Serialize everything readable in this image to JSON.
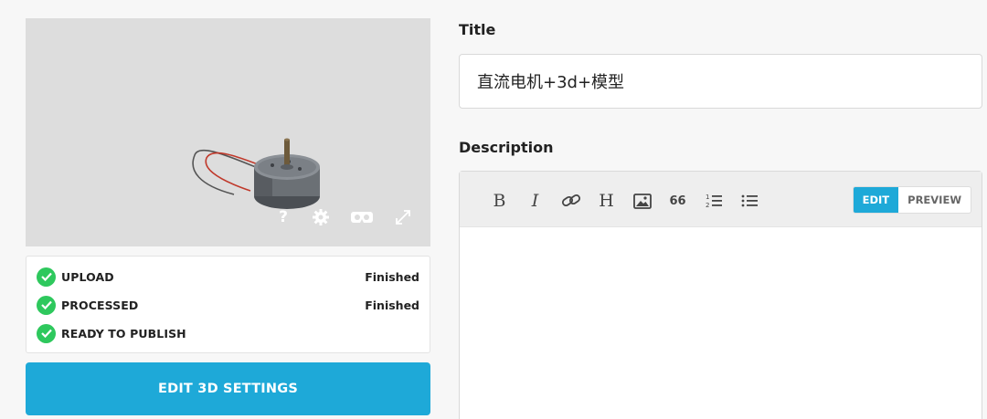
{
  "viewer": {
    "controls": [
      "help-icon",
      "settings-icon",
      "vr-icon",
      "fullscreen-icon"
    ],
    "help_glyph": "?"
  },
  "status": {
    "items": [
      {
        "label": "UPLOAD",
        "state": "Finished"
      },
      {
        "label": "PROCESSED",
        "state": "Finished"
      },
      {
        "label": "READY TO PUBLISH",
        "state": ""
      }
    ]
  },
  "edit_button": {
    "label": "EDIT 3D SETTINGS"
  },
  "form": {
    "title_label": "Title",
    "title_value": "直流电机+3d+模型",
    "description_label": "Description"
  },
  "editor": {
    "toolbar": {
      "bold": "B",
      "italic": "I",
      "heading": "H",
      "quote": "66"
    },
    "modes": {
      "edit": "EDIT",
      "preview": "PREVIEW"
    },
    "active_mode": "EDIT"
  },
  "colors": {
    "accent": "#1ea9d8",
    "success": "#2ec85d",
    "viewer_bg": "#dddddd"
  }
}
